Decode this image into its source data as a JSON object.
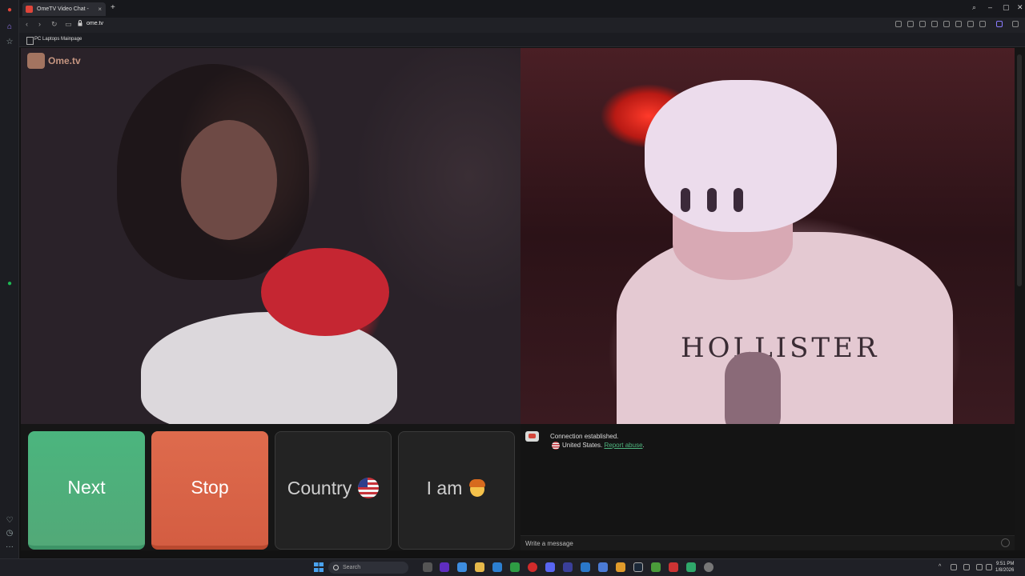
{
  "browser": {
    "tab_title": "OmeTV Video Chat -",
    "url": "ome.tv",
    "bookmark": "PC Laptops Mainpage"
  },
  "video": {
    "logo_text": "Ome.tv",
    "shirt_text": "HOLLISTER"
  },
  "controls": {
    "next_label": "Next",
    "stop_label": "Stop",
    "country_label": "Country",
    "iam_label": "I am"
  },
  "chat": {
    "status": "Connection established.",
    "country": "United States.",
    "report_link": "Report abuse",
    "report_trail": ".",
    "input_placeholder": "Write a message"
  },
  "taskbar": {
    "search_placeholder": "Search",
    "time": "9:51 PM",
    "date": "1/8/2026"
  },
  "colors": {
    "next": "#4bb57e",
    "stop": "#de6b4d",
    "report_link": "#4fb57f"
  }
}
